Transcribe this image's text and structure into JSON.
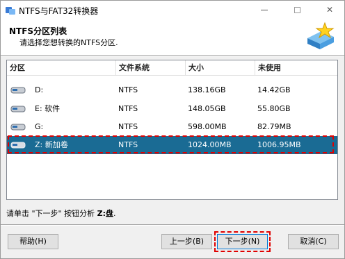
{
  "window": {
    "title": "NTFS与FAT32转换器"
  },
  "header": {
    "title": "NTFS分区列表",
    "subtitle": "请选择您想转换的NTFS分区."
  },
  "table": {
    "columns": [
      "分区",
      "文件系统",
      "大小",
      "未使用"
    ],
    "rows": [
      {
        "partition": "D:",
        "fs": "NTFS",
        "size": "138.16GB",
        "free": "14.42GB"
      },
      {
        "partition": "E: 软件",
        "fs": "NTFS",
        "size": "148.05GB",
        "free": "55.80GB"
      },
      {
        "partition": "G:",
        "fs": "NTFS",
        "size": "598.00MB",
        "free": "82.79MB"
      },
      {
        "partition": "Z: 新加卷",
        "fs": "NTFS",
        "size": "1024.00MB",
        "free": "1006.95MB"
      }
    ],
    "selected_index": 3
  },
  "status": {
    "prefix": "请单击 \"下一步\" 按钮分析 ",
    "drive": "Z:盘",
    "suffix": "."
  },
  "buttons": {
    "help": "帮助(H)",
    "back": "上一步(B)",
    "next": "下一步(N)",
    "cancel": "取消(C)"
  },
  "colors": {
    "selected_row": "#1a6b94",
    "highlight_outline": "#e00000"
  },
  "icons": {
    "app": "convert-icon",
    "header": "disk-star-icon",
    "partition": "hard-disk-icon"
  }
}
